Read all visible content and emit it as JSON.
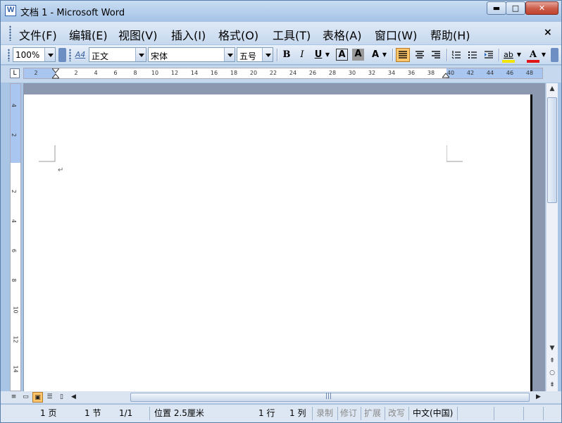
{
  "window": {
    "title": "文档 1 - Microsoft Word",
    "min_glyph": "▬",
    "max_glyph": "□",
    "close_glyph": "✕"
  },
  "menu": {
    "items": [
      "文件(F)",
      "编辑(E)",
      "视图(V)",
      "插入(I)",
      "格式(O)",
      "工具(T)",
      "表格(A)",
      "窗口(W)",
      "帮助(H)"
    ],
    "close_glyph": "×"
  },
  "toolbar": {
    "zoom": "100%",
    "style": "正文",
    "font": "宋体",
    "size": "五号",
    "bold": "B",
    "italic": "I",
    "underline": "U",
    "style_icon": "A4",
    "char_border": "A",
    "char_shading": "A",
    "scale_icon": "A",
    "highlight": "ab",
    "font_color": "A",
    "align_active": "justify",
    "highlight_color": "#f2e600",
    "font_color_value": "#e1141a"
  },
  "ruler": {
    "h_ticks": [
      "2",
      "2",
      "4",
      "6",
      "8",
      "10",
      "12",
      "14",
      "16",
      "18",
      "20",
      "22",
      "24",
      "26",
      "28",
      "30",
      "32",
      "34",
      "36",
      "38",
      "40",
      "42",
      "44",
      "46",
      "48"
    ],
    "v_ticks": [
      "4",
      "2",
      "2",
      "4",
      "6",
      "8",
      "10",
      "12",
      "14"
    ],
    "corner_glyph": "L"
  },
  "document": {
    "paragraph_mark": "↵"
  },
  "scroll": {
    "up": "▲",
    "down": "▼",
    "prev_page": "⇞",
    "select_browse": "○",
    "next_page": "⇟",
    "left": "◀",
    "right": "▶",
    "grip": "|||"
  },
  "status": {
    "page": "1 页",
    "section": "1 节",
    "page_count": "1/1",
    "position": "位置 2.5厘米",
    "line": "1 行",
    "column": "1 列",
    "rec": "录制",
    "trk": "修订",
    "ext": "扩展",
    "ovr": "改写",
    "language": "中文(中国)"
  }
}
